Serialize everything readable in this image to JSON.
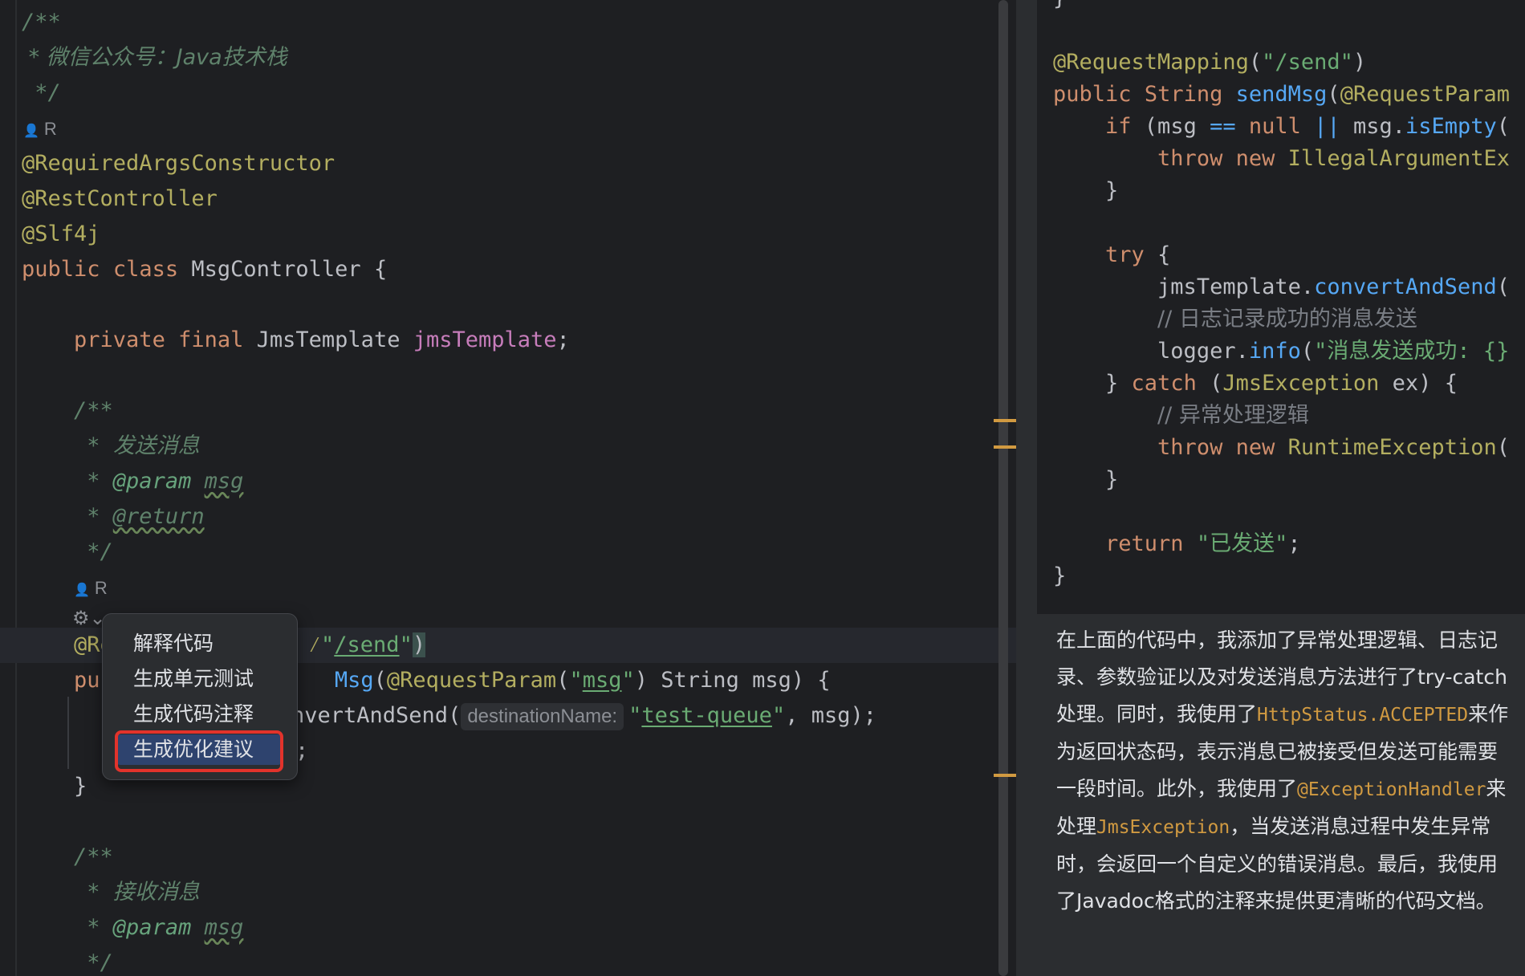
{
  "colors": {
    "editor_bg": "#1e1f22",
    "panel_bg": "#2b2d30",
    "keyword": "#cf8e6d",
    "annotation": "#b3ae60",
    "field": "#c77dbb",
    "string": "#6aab73",
    "method": "#56a8f5",
    "doc_comment": "#5f826b",
    "menu_selected": "#2e436e",
    "callout_border": "#e2332b"
  },
  "editor": {
    "doc1": {
      "open": "/**",
      "wechat": " * 微信公众号：Java技术栈",
      "close": " */"
    },
    "author_initial": "R",
    "annotations": {
      "a1": "@RequiredArgsConstructor",
      "a2": "@RestController",
      "a3": "@Slf4j"
    },
    "class_decl": {
      "public": "public",
      "class": "class",
      "name": "MsgController",
      "brace": " {"
    },
    "field_decl": {
      "private": "private",
      "final": "final",
      "type": "JmsTemplate",
      "name": "jmsTemplate",
      "semi": ";"
    },
    "doc2": {
      "open": "/**",
      "star": " * ",
      "text": "发送消息",
      "param_tag": "@param",
      "param_name": "msg",
      "return_tag": "@return",
      "close": " */"
    },
    "method_ann": {
      "prefix": "@Re",
      "path": "/send"
    },
    "method_sig": {
      "prefix": "pub",
      "name_tail": "Msg",
      "req_param": "@RequestParam",
      "param_str": "msg",
      "rest": " String msg) {"
    },
    "send_line": {
      "prefix": "nvertAndSend(",
      "hint": "destinationName:",
      "queue": "test-queue",
      "rest": ", msg);"
    },
    "line4": ";",
    "closing_brace": "}",
    "doc3": {
      "open": "/**",
      "text": "接收消息",
      "param_tag": "@param",
      "param_name": "msg",
      "close": " */"
    }
  },
  "popup_menu": {
    "items": [
      "解释代码",
      "生成单元测试",
      "生成代码注释",
      "生成优化建议"
    ],
    "selected_index": 3
  },
  "right_code": {
    "top_brace": "}",
    "mapping": "@RequestMapping",
    "mapping_path": "\"/send\"",
    "sig": {
      "public": "public",
      "type": "String",
      "name": "sendMsg",
      "param": "@RequestParam"
    },
    "if_line": {
      "if": "if",
      "cond1": " (msg ",
      "eq": "==",
      "null": "null",
      "or": "||",
      "msg": " msg.",
      "call": "isEmpty",
      "paren": "("
    },
    "throw1": {
      "throw": "throw",
      "new": "new",
      "cls": "IllegalArgumentEx"
    },
    "close1": "}",
    "try": "try",
    "convert": {
      "obj": "jmsTemplate.",
      "call": "convertAndSend",
      "paren": "("
    },
    "comment1": "// 日志记录成功的消息发送",
    "logger": {
      "obj": "logger.",
      "call": "info",
      "str": "\"消息发送成功: {}"
    },
    "catch": {
      "close": "} ",
      "catch": "catch",
      "type": "JmsException",
      "rest": " ex) {"
    },
    "comment2": "// 异常处理逻辑",
    "throw2": {
      "throw": "throw",
      "new": "new",
      "cls": "RuntimeException",
      "paren": "("
    },
    "close2": "}",
    "return": {
      "return": "return",
      "str": "\"已发送\"",
      "semi": ";"
    },
    "close3": "}"
  },
  "chat": {
    "p1": "在上面的代码中，我添加了异常处理逻辑、日志记录、参数验证以及对发送消息方法进行了try-catch处理。同时，我使用了",
    "code1": "HttpStatus.ACCEPTED",
    "p2": "来作为返回状态码，表示消息已被接受但发送可能需要一段时间。此外，我使用了",
    "code2": "@ExceptionHandler",
    "p3": "来处理",
    "code3": "JmsException",
    "p4": "，当发送消息过程中发生异常时，会返回一个自定义的错误消息。最后，我使用了Javadoc格式的注释来提供更清晰的代码文档。"
  }
}
